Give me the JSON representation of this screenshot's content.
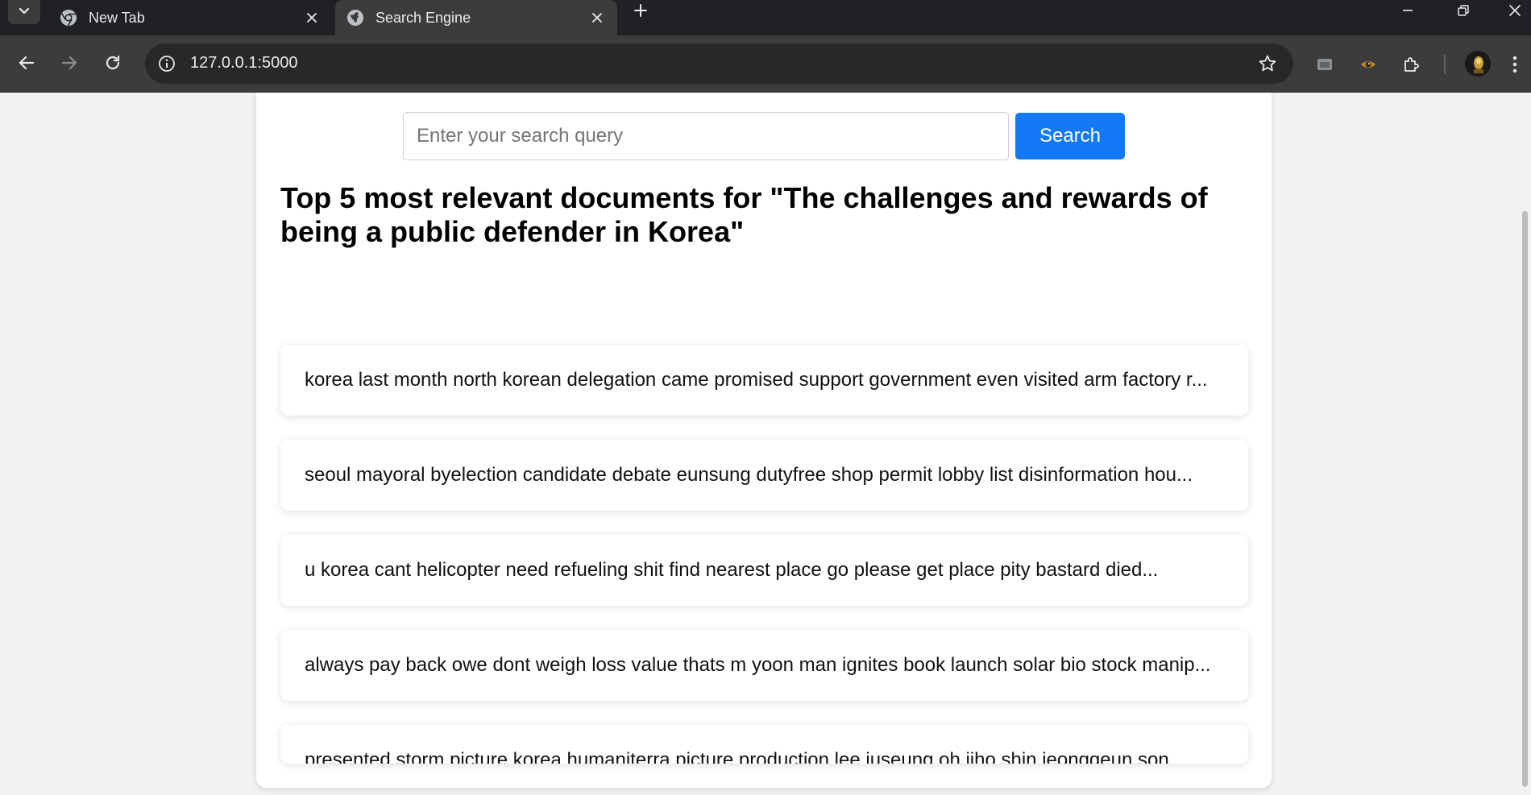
{
  "browser": {
    "tabs": [
      {
        "title": "New Tab",
        "icon": "chrome-icon",
        "active": false
      },
      {
        "title": "Search Engine",
        "icon": "globe-icon",
        "active": true
      }
    ],
    "address": "127.0.0.1:5000"
  },
  "page": {
    "search": {
      "placeholder": "Enter your search query",
      "value": "",
      "button_label": "Search"
    },
    "heading": "Top 5 most relevant documents for \"The challenges and rewards of being a public defender in Korea\"",
    "results": [
      "korea last month north korean delegation came promised support government even visited arm factory r...",
      "seoul mayoral byelection candidate debate eunsung dutyfree shop permit lobby list disinformation hou...",
      "u korea cant helicopter need refueling shit find nearest place go please get place pity bastard died...",
      "always pay back owe dont weigh loss value thats m yoon man ignites book launch solar bio stock manip...",
      "presented storm picture korea humaniterra picture production lee juseung oh jiho shin jeonggeun son ..."
    ]
  },
  "colors": {
    "accent": "#1479f5",
    "chrome_dark": "#202124",
    "toolbar": "#3c3c3c",
    "page_bg": "#f2f2f2"
  }
}
